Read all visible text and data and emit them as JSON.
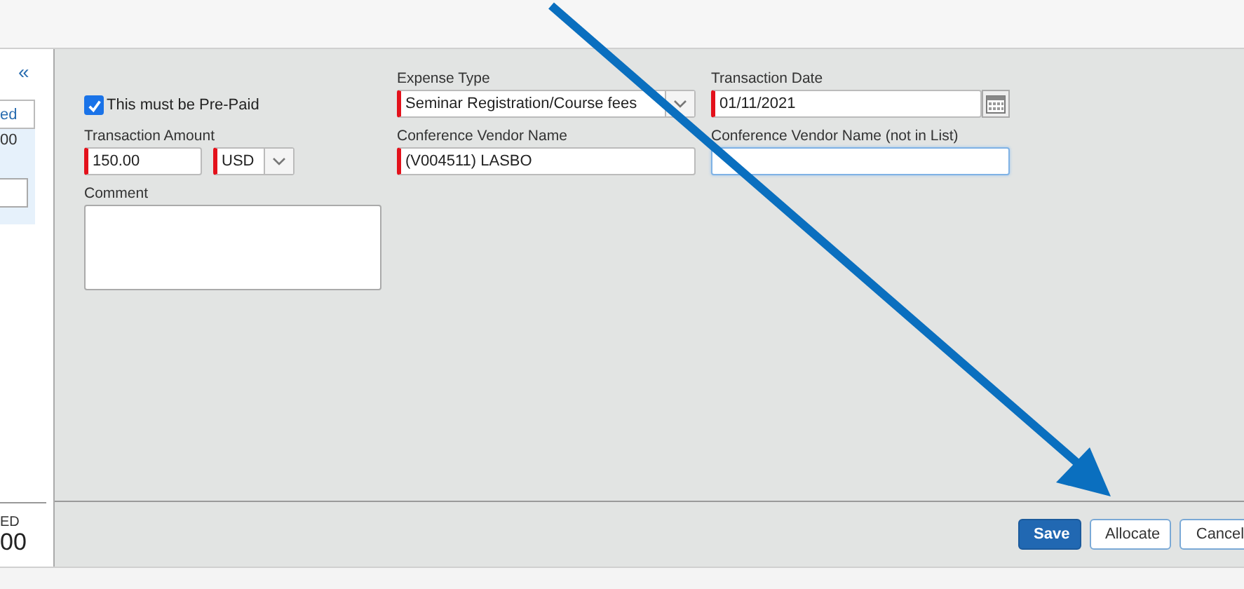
{
  "sidebar": {
    "collapse_icon": "«",
    "column_header": "ed",
    "amount": "00",
    "total_label": "ED",
    "total": "00"
  },
  "form": {
    "prepaid": {
      "label": "This must be Pre-Paid",
      "checked": true
    },
    "expense_type": {
      "label": "Expense Type",
      "value": "Seminar Registration/Course fees",
      "required": true,
      "focused": false
    },
    "transaction_date": {
      "label": "Transaction Date",
      "value": "01/11/2021",
      "required": true,
      "focused": false
    },
    "transaction_amount": {
      "label": "Transaction Amount",
      "value": "150.00",
      "required": true,
      "focused": false
    },
    "currency": {
      "value": "USD",
      "required": true,
      "focused": false
    },
    "vendor": {
      "label": "Conference Vendor Name",
      "value": "(V004511) LASBO",
      "required": true,
      "focused": false
    },
    "vendor_other": {
      "label": "Conference Vendor Name (not in List)",
      "required": false,
      "focused": true
    },
    "comment": {
      "label": "Comment"
    }
  },
  "buttons": [
    {
      "label": "Save",
      "kind": "primary"
    },
    {
      "label": "Allocate",
      "kind": "secondary"
    },
    {
      "label": "Cancel",
      "kind": "secondary"
    }
  ]
}
